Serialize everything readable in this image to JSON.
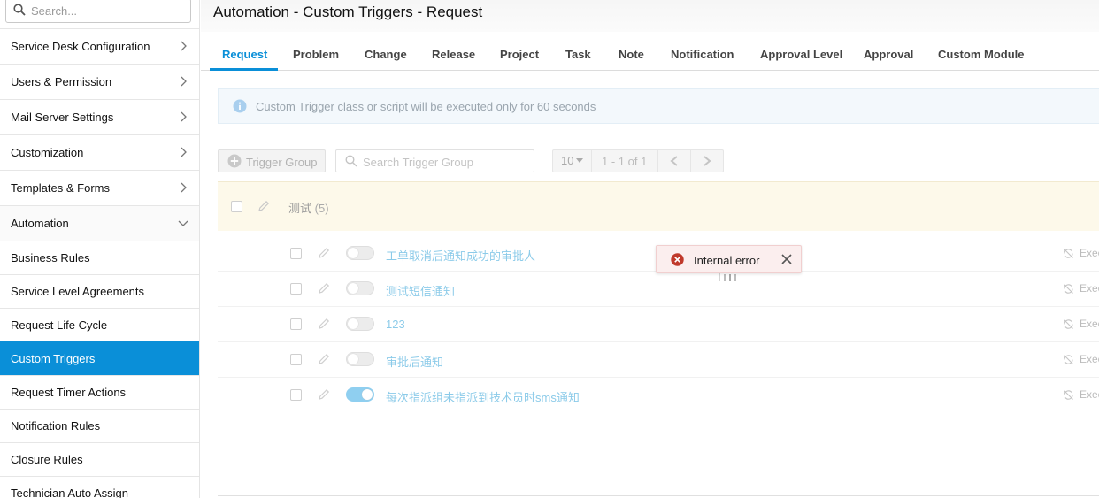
{
  "sidebar": {
    "search_placeholder": "Search...",
    "menu": [
      {
        "label": "Service Desk Configuration",
        "expanded": false
      },
      {
        "label": "Users & Permission",
        "expanded": false
      },
      {
        "label": "Mail Server Settings",
        "expanded": false
      },
      {
        "label": "Customization",
        "expanded": false
      },
      {
        "label": "Templates & Forms",
        "expanded": false
      },
      {
        "label": "Automation",
        "expanded": true
      }
    ],
    "automation_items": [
      {
        "label": "Business Rules",
        "active": false
      },
      {
        "label": "Service Level Agreements",
        "active": false
      },
      {
        "label": "Request Life Cycle",
        "active": false
      },
      {
        "label": "Custom Triggers",
        "active": true
      },
      {
        "label": "Request Timer Actions",
        "active": false
      },
      {
        "label": "Notification Rules",
        "active": false
      },
      {
        "label": "Closure Rules",
        "active": false
      },
      {
        "label": "Technician Auto Assign",
        "active": false
      }
    ]
  },
  "header": {
    "title": "Automation - Custom Triggers - Request"
  },
  "tabs": {
    "items": [
      "Request",
      "Problem",
      "Change",
      "Release",
      "Project",
      "Task",
      "Note",
      "Notification",
      "Approval Level",
      "Approval",
      "Custom Module"
    ],
    "active": "Request"
  },
  "info_banner": {
    "text": "Custom Trigger class or script will be executed only for 60 seconds"
  },
  "toolbar": {
    "trigger_group_button": "Trigger Group",
    "search_placeholder": "Search Trigger Group",
    "page_size": "10",
    "range": "1 - 1 of 1"
  },
  "group": {
    "name": "测试",
    "count": "(5)"
  },
  "triggers": [
    {
      "name": "工单取消后通知成功的审批人",
      "enabled": false,
      "action": "Exec"
    },
    {
      "name": "测试短信通知",
      "enabled": false,
      "action": "Exec"
    },
    {
      "name": "123",
      "enabled": false,
      "action": "Exec"
    },
    {
      "name": "审批后通知",
      "enabled": false,
      "action": "Exec"
    },
    {
      "name": "每次指派组未指派到技术员时sms通知",
      "enabled": true,
      "action": "Exec"
    }
  ],
  "toast": {
    "message": "Internal error"
  },
  "colors": {
    "accent": "#0a8fd8",
    "error": "#c0392b",
    "group_row_bg": "#fdf9ea",
    "trigger_name": "#8ccbe9"
  }
}
